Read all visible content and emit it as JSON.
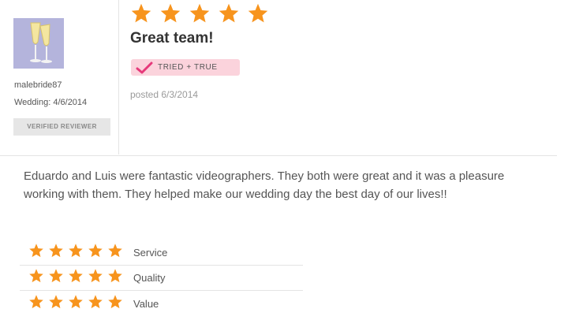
{
  "reviewer": {
    "username": "malebride87",
    "wedding_label": "Wedding:",
    "wedding_date": "4/6/2014",
    "verified_label": "VERIFIED REVIEWER",
    "avatar_icon": "champagne-glasses-icon"
  },
  "review": {
    "overall_rating": 5,
    "max_rating": 5,
    "title": "Great team!",
    "badge_label": "TRIED + TRUE",
    "posted": "posted 6/3/2014",
    "body": "Eduardo and Luis were fantastic videographers. They both were great and it was a pleasure working with them. They helped make our wedding day the best day of our lives!!"
  },
  "ratings": [
    {
      "label": "Service",
      "stars": 5
    },
    {
      "label": "Quality",
      "stars": 5
    },
    {
      "label": "Value",
      "stars": 5
    }
  ],
  "colors": {
    "star": "#f7941d",
    "badge_bg": "#fbd3dc",
    "badge_check": "#e6397a",
    "avatar_bg": "#b4b4dc"
  }
}
